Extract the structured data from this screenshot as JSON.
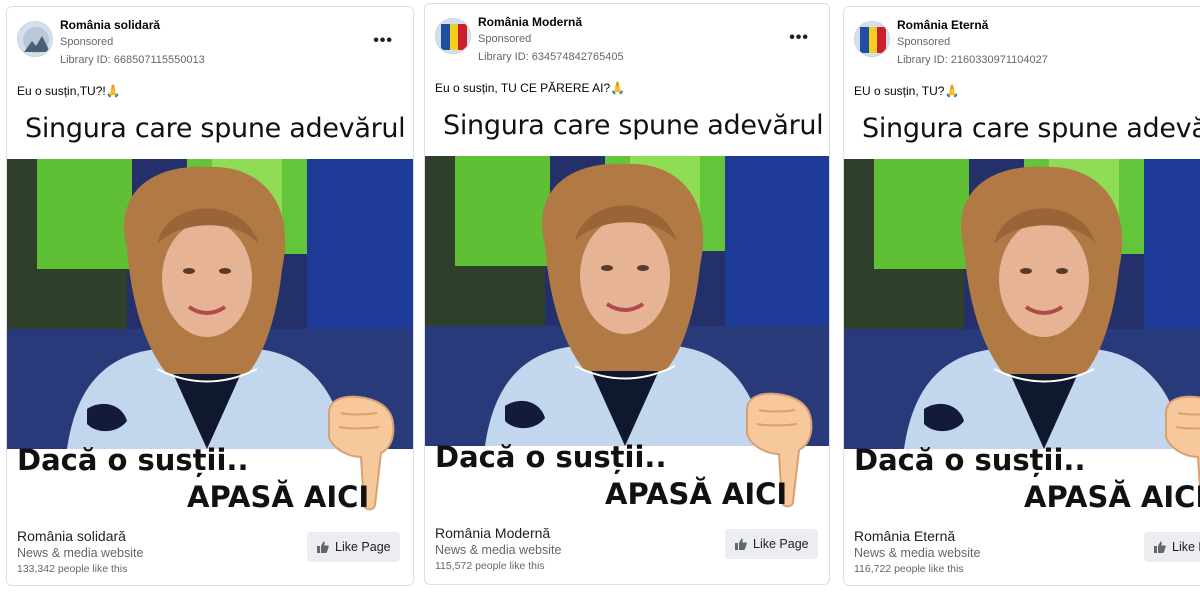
{
  "colors": {
    "card_border": "#dddfe2",
    "muted_text": "#65676b",
    "like_button_bg": "#ebedf0",
    "photo_green": "#4fbf2a",
    "photo_blue": "#1d3f9c",
    "jacket": "#bcd0ea"
  },
  "ads": [
    {
      "page_name": "România solidară",
      "sponsored": "Sponsored",
      "library_id": "Library ID: 668507115550013",
      "more_icon": "more-options-icon",
      "caption": "Eu o susțin,TU?!🙏",
      "headline": "Singura care spune adevărul",
      "cta_line1": "Dacă o susții..",
      "cta_line2": "APASĂ AICI",
      "footer_name": "România solidară",
      "footer_category": "News & media website",
      "footer_likes": "133,342 people like this",
      "like_button": "Like Page"
    },
    {
      "page_name": "România Modernă",
      "sponsored": "Sponsored",
      "library_id": "Library ID: 634574842765405",
      "more_icon": "more-options-icon",
      "caption": "Eu o susțin, TU CE PĂRERE AI?🙏",
      "headline": "Singura care spune adevărul",
      "cta_line1": "Dacă o susții..",
      "cta_line2": "APASĂ AICI",
      "footer_name": "România Modernă",
      "footer_category": "News & media website",
      "footer_likes": "115,572 people like this",
      "like_button": "Like Page"
    },
    {
      "page_name": "România Eternă",
      "sponsored": "Sponsored",
      "library_id": "Library ID: 2160330971104027",
      "more_icon": "more-options-icon",
      "caption": "EU o susțin, TU?🙏",
      "headline": "Singura care spune adevărul",
      "cta_line1": "Dacă o susții..",
      "cta_line2": "APASĂ AICI",
      "footer_name": "România Eternă",
      "footer_category": "News & media website",
      "footer_likes": "116,722 people like this",
      "like_button": "Like Page"
    }
  ]
}
